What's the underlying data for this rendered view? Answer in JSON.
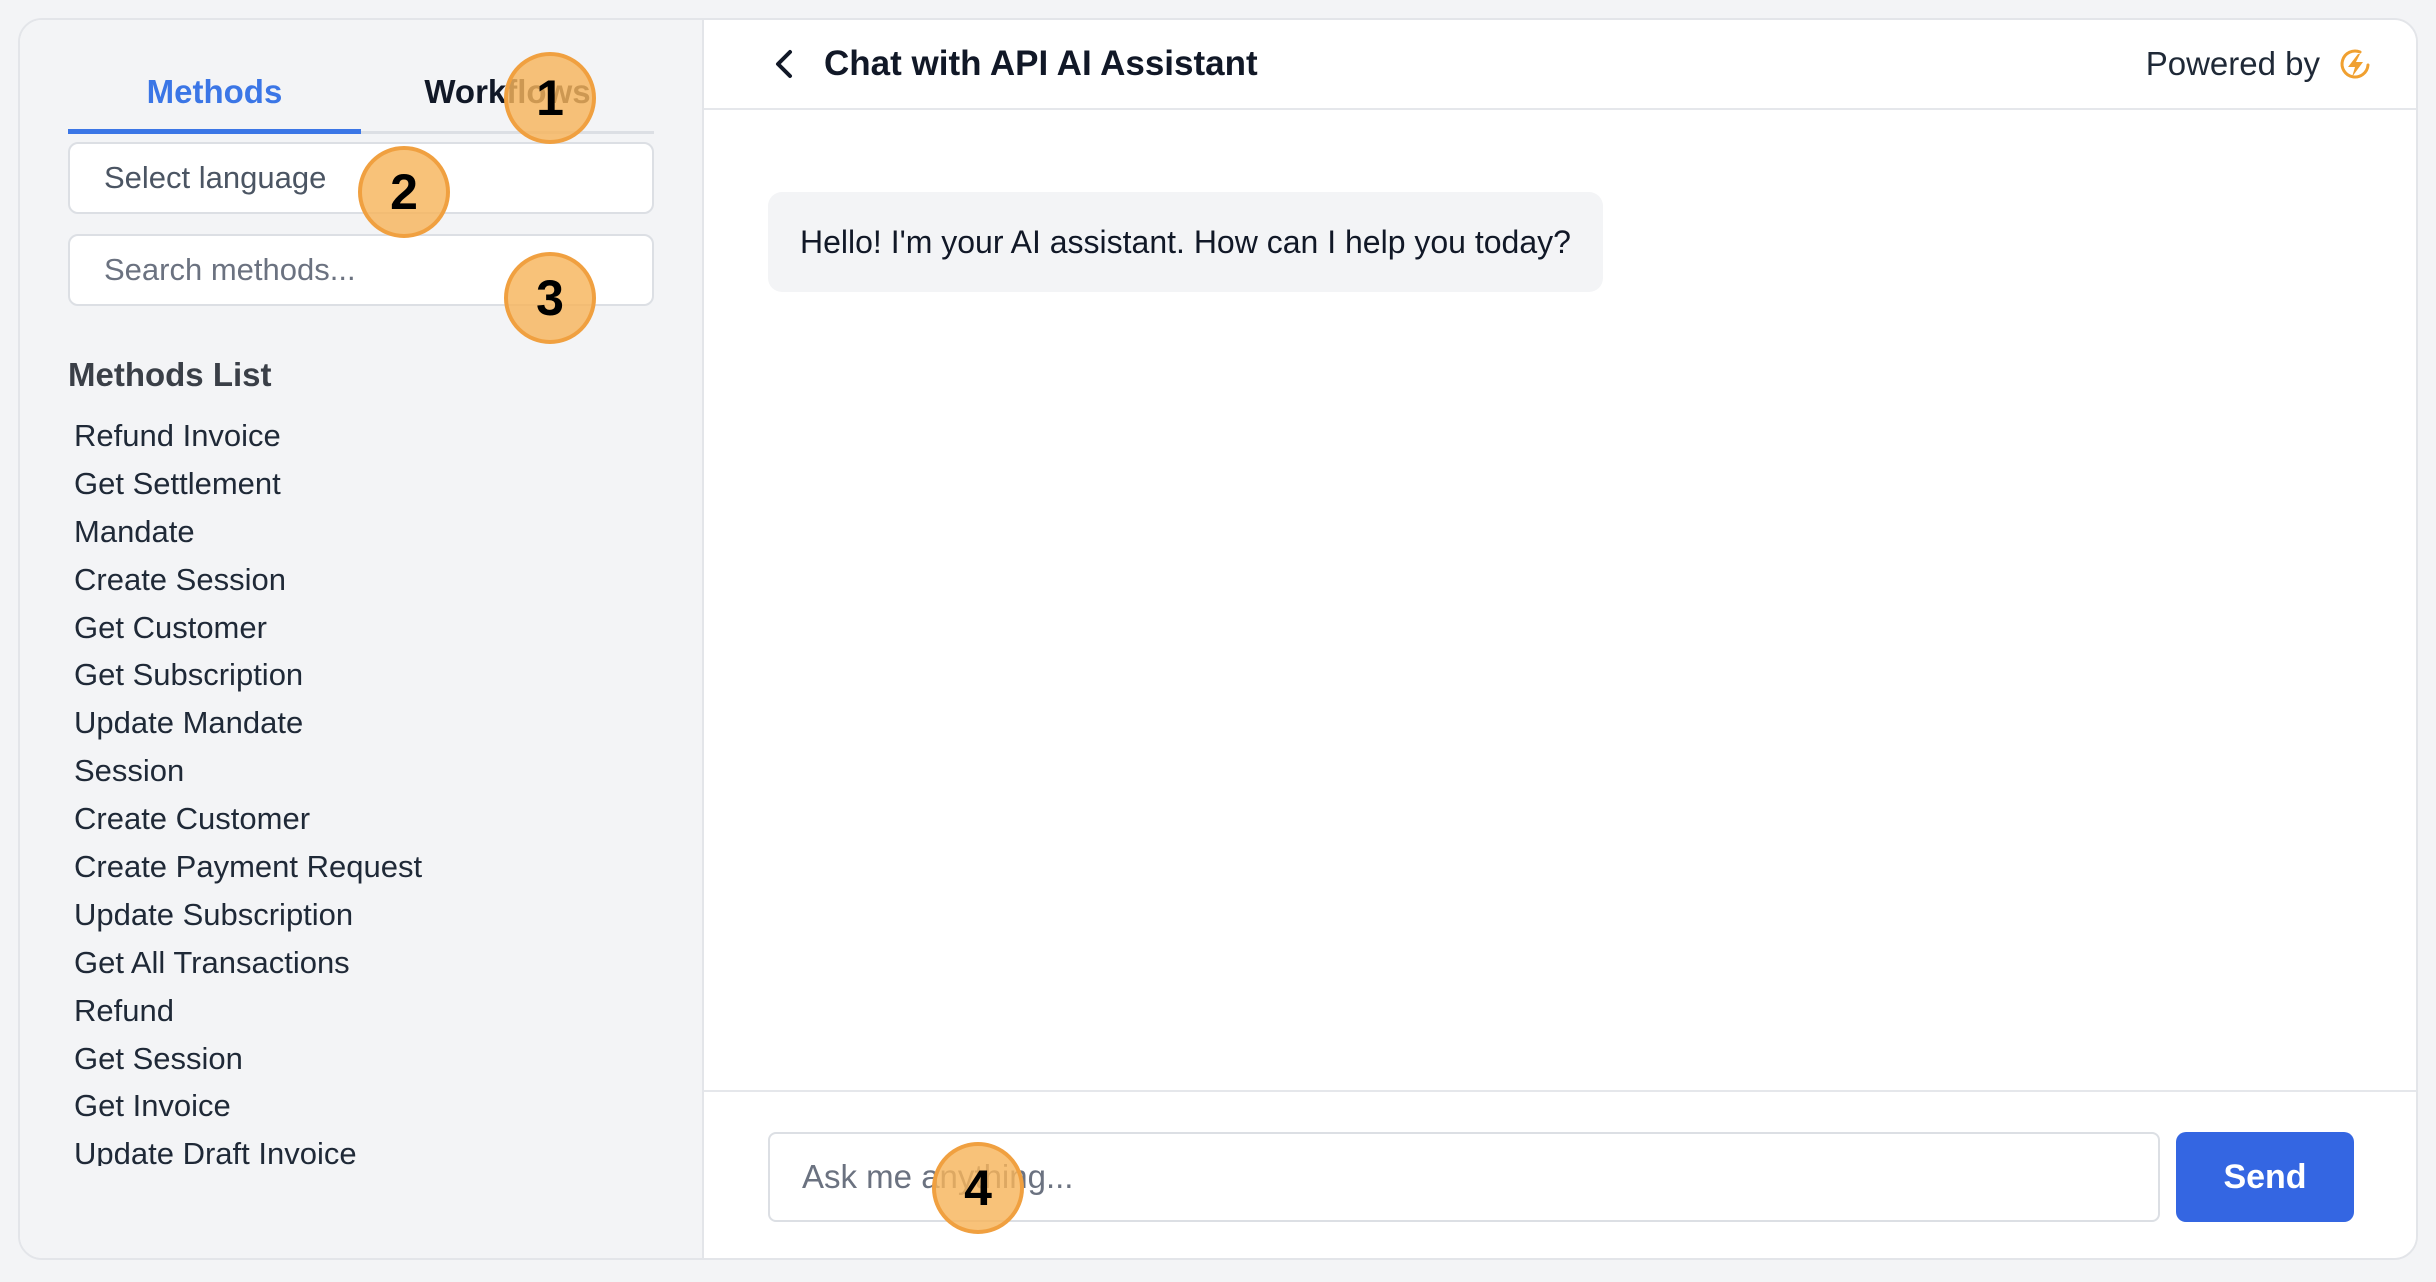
{
  "sidebar": {
    "tabs": [
      {
        "label": "Methods",
        "active": true
      },
      {
        "label": "Workflows",
        "active": false
      }
    ],
    "language_select": {
      "value": "Select language"
    },
    "search": {
      "placeholder": "Search methods..."
    },
    "methods_heading": "Methods List",
    "methods": [
      "Refund Invoice",
      "Get Settlement",
      "Mandate",
      "Create Session",
      "Get Customer",
      "Get Subscription",
      "Update Mandate",
      "Session",
      "Create Customer",
      "Create Payment Request",
      "Update Subscription",
      "Get All Transactions",
      "Refund",
      "Get Session",
      "Get Invoice",
      "Update Draft Invoice"
    ]
  },
  "chat": {
    "title": "Chat with API AI Assistant",
    "powered_by": "Powered by",
    "messages": [
      {
        "role": "assistant",
        "text": "Hello! I'm your AI assistant. How can I help you today?"
      }
    ],
    "composer": {
      "placeholder": "Ask me anything...",
      "send_label": "Send"
    }
  },
  "markers": [
    "1",
    "2",
    "3",
    "4"
  ],
  "colors": {
    "accent": "#3b76e6",
    "send_button": "#3466e2",
    "marker_fill": "#f6b45c",
    "logo": "#f0a030"
  },
  "icons": {
    "back": "chevron-left-icon",
    "logo": "lightning-logo-icon"
  }
}
